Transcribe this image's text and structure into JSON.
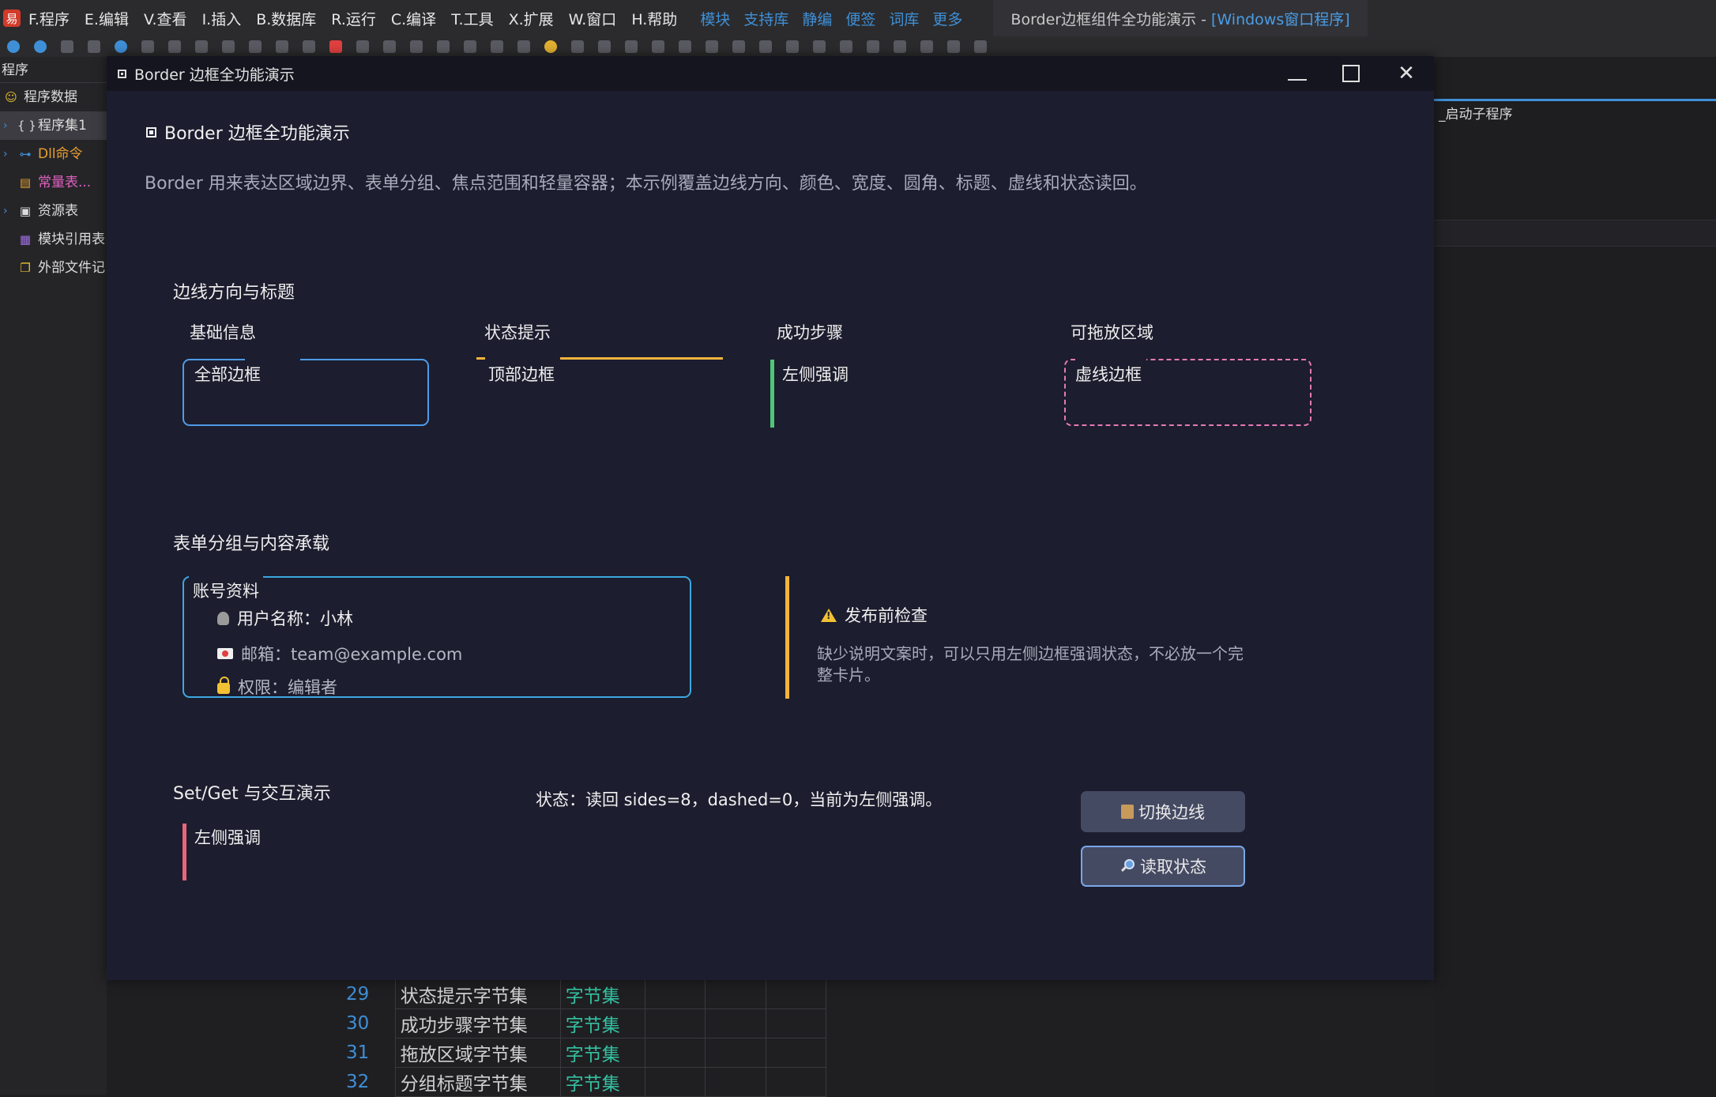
{
  "ide": {
    "logo_glyph": "易",
    "menu": [
      "F.程序",
      "E.编辑",
      "V.查看",
      "I.插入",
      "B.数据库",
      "R.运行",
      "C.编译",
      "T.工具",
      "X.扩展",
      "W.窗口",
      "H.帮助"
    ],
    "links": [
      "模块",
      "支持库",
      "静编",
      "便签",
      "词库",
      "更多"
    ],
    "title_main": "Border边框组件全功能演示 -",
    "title_sub": "[Windows窗口程序]",
    "sidebar_header": "程序",
    "sidebar": [
      {
        "label": "程序数据",
        "icon": "smiley-icon",
        "glyph": "☺"
      },
      {
        "label": "程序集1",
        "icon": "braces-icon",
        "glyph": "{ }"
      },
      {
        "label": "Dll命令",
        "icon": "dll-icon",
        "glyph": "⊶"
      },
      {
        "label": "常量表...",
        "icon": "constant-icon",
        "glyph": "▤"
      },
      {
        "label": "资源表",
        "icon": "resource-icon",
        "glyph": "▣"
      },
      {
        "label": "模块引用表",
        "icon": "module-icon",
        "glyph": "▦"
      },
      {
        "label": "外部文件记",
        "icon": "file-icon",
        "glyph": "❐"
      }
    ],
    "right_panel_tab": "_启动子程序",
    "code_rows": [
      {
        "line": "29",
        "name": "状态提示字节集",
        "type": "字节集"
      },
      {
        "line": "30",
        "name": "成功步骤字节集",
        "type": "字节集"
      },
      {
        "line": "31",
        "name": "拖放区域字节集",
        "type": "字节集"
      },
      {
        "line": "32",
        "name": "分组标题字节集",
        "type": "字节集"
      }
    ]
  },
  "window": {
    "title": "Border 边框全功能演示"
  },
  "header": {
    "title": "Border 边框全功能演示",
    "description": "Border 用来表达区域边界、表单分组、焦点范围和轻量容器；本示例覆盖边线方向、颜色、宽度、圆角、标题、虚线和状态读回。"
  },
  "sections": {
    "directions": {
      "title": "边线方向与标题",
      "columns": [
        {
          "title": "基础信息",
          "label": "全部边框"
        },
        {
          "title": "状态提示",
          "label": "顶部边框"
        },
        {
          "title": "成功步骤",
          "label": "左侧强调"
        },
        {
          "title": "可拖放区域",
          "label": "虚线边框"
        }
      ]
    },
    "forms": {
      "title": "表单分组与内容承载",
      "group": {
        "title": "账号资料",
        "rows": [
          {
            "text": "用户名称：小林",
            "icon": "user-icon"
          },
          {
            "text": "邮箱：team@example.com",
            "icon": "mail-icon"
          },
          {
            "text": "权限：编辑者",
            "icon": "lock-icon"
          }
        ]
      },
      "warning": {
        "title": "发布前检查",
        "description": "缺少说明文案时，可以只用左侧边框强调状态，不必放一个完整卡片。"
      }
    },
    "setget": {
      "title": "Set/Get 与交互演示",
      "label": "左侧强调",
      "status": "状态：读回 sides=8，dashed=0，当前为左侧强调。",
      "buttons": {
        "toggle": "切换边线",
        "read": "读取状态"
      }
    }
  },
  "colors": {
    "blue_border": "#4e9be8",
    "yellow_border": "#f2b53c",
    "green_border": "#4fc675",
    "pink_dashed": "#e57ab6",
    "group_border": "#3ca7df",
    "red_border": "#e9667a"
  }
}
